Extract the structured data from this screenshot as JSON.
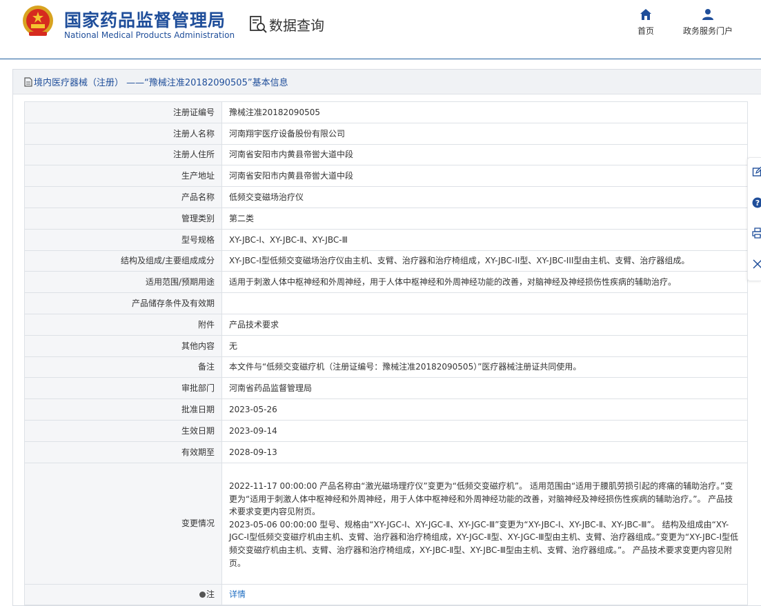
{
  "header": {
    "brand_cn": "国家药品监督管理局",
    "brand_en": "National Medical Products Administration",
    "query_label": "数据查询",
    "nav": [
      {
        "label": "首页",
        "icon": "home-icon"
      },
      {
        "label": "政务服务门户",
        "icon": "user-icon"
      }
    ]
  },
  "panel": {
    "title": "境内医疗器械（注册） ——“豫械注准20182090505”基本信息"
  },
  "rows": [
    {
      "label": "注册证编号",
      "value": "豫械注准20182090505"
    },
    {
      "label": "注册人名称",
      "value": "河南翔宇医疗设备股份有限公司"
    },
    {
      "label": "注册人住所",
      "value": "河南省安阳市内黄县帝喾大道中段"
    },
    {
      "label": "生产地址",
      "value": "河南省安阳市内黄县帝喾大道中段"
    },
    {
      "label": "产品名称",
      "value": "低频交变磁场治疗仪"
    },
    {
      "label": "管理类别",
      "value": "第二类"
    },
    {
      "label": "型号规格",
      "value": "XY-JBC-Ⅰ、XY-JBC-Ⅱ、XY-JBC-Ⅲ"
    },
    {
      "label": "结构及组成/主要组成成分",
      "value": "XY-JBC-I型低频交变磁场治疗仪由主机、支臂、治疗器和治疗椅组成，XY-JBC-II型、XY-JBC-III型由主机、支臂、治疗器组成。"
    },
    {
      "label": "适用范围/预期用途",
      "value": "适用于刺激人体中枢神经和外周神经，用于人体中枢神经和外周神经功能的改善，对脑神经及神经损伤性疾病的辅助治疗。"
    },
    {
      "label": "产品储存条件及有效期",
      "value": ""
    },
    {
      "label": "附件",
      "value": "产品技术要求"
    },
    {
      "label": "其他内容",
      "value": "无"
    },
    {
      "label": "备注",
      "value": "本文件与“低频交变磁疗机（注册证编号：豫械注准20182090505）”医疗器械注册证共同使用。"
    },
    {
      "label": "审批部门",
      "value": "河南省药品监督管理局"
    },
    {
      "label": "批准日期",
      "value": "2023-05-26"
    },
    {
      "label": "生效日期",
      "value": "2023-09-14"
    },
    {
      "label": "有效期至",
      "value": "2028-09-13"
    }
  ],
  "change": {
    "label": "变更情况",
    "entries": [
      "2022-11-17 00:00:00 产品名称由“激光磁场理疗仪”变更为“低频交变磁疗机”。 适用范围由“适用于腰肌劳损引起的疼痛的辅助治疗。”变更为“适用于刺激人体中枢神经和外周神经，用于人体中枢神经和外周神经功能的改善，对脑神经及神经损伤性疾病的辅助治疗。”。 产品技术要求变更内容见附页。",
      "2023-05-06 00:00:00 型号、规格由“XY-JGC-Ⅰ、XY-JGC-Ⅱ、XY-JGC-Ⅲ”变更为“XY-JBC-Ⅰ、XY-JBC-Ⅱ、XY-JBC-Ⅲ”。 结构及组成由“XY-JGC-Ⅰ型低频交变磁疗机由主机、支臂、治疗器和治疗椅组成，XY-JGC-Ⅱ型、XY-JGC-Ⅲ型由主机、支臂、治疗器组成。”变更为“XY-JBC-Ⅰ型低频交变磁疗机由主机、支臂、治疗器和治疗椅组成，XY-JBC-Ⅱ型、XY-JBC-Ⅲ型由主机、支臂、治疗器组成。”。 产品技术要求变更内容见附页。"
    ]
  },
  "note": {
    "label": "注",
    "link": "详情"
  },
  "side_tools": [
    "edit-icon",
    "help-icon",
    "print-icon",
    "close-icon"
  ],
  "colors": {
    "brand": "#1f4e9a",
    "link": "#1f6ec2",
    "label_bg": "#f5f6f8",
    "header_bg": "#f0f2f5"
  }
}
